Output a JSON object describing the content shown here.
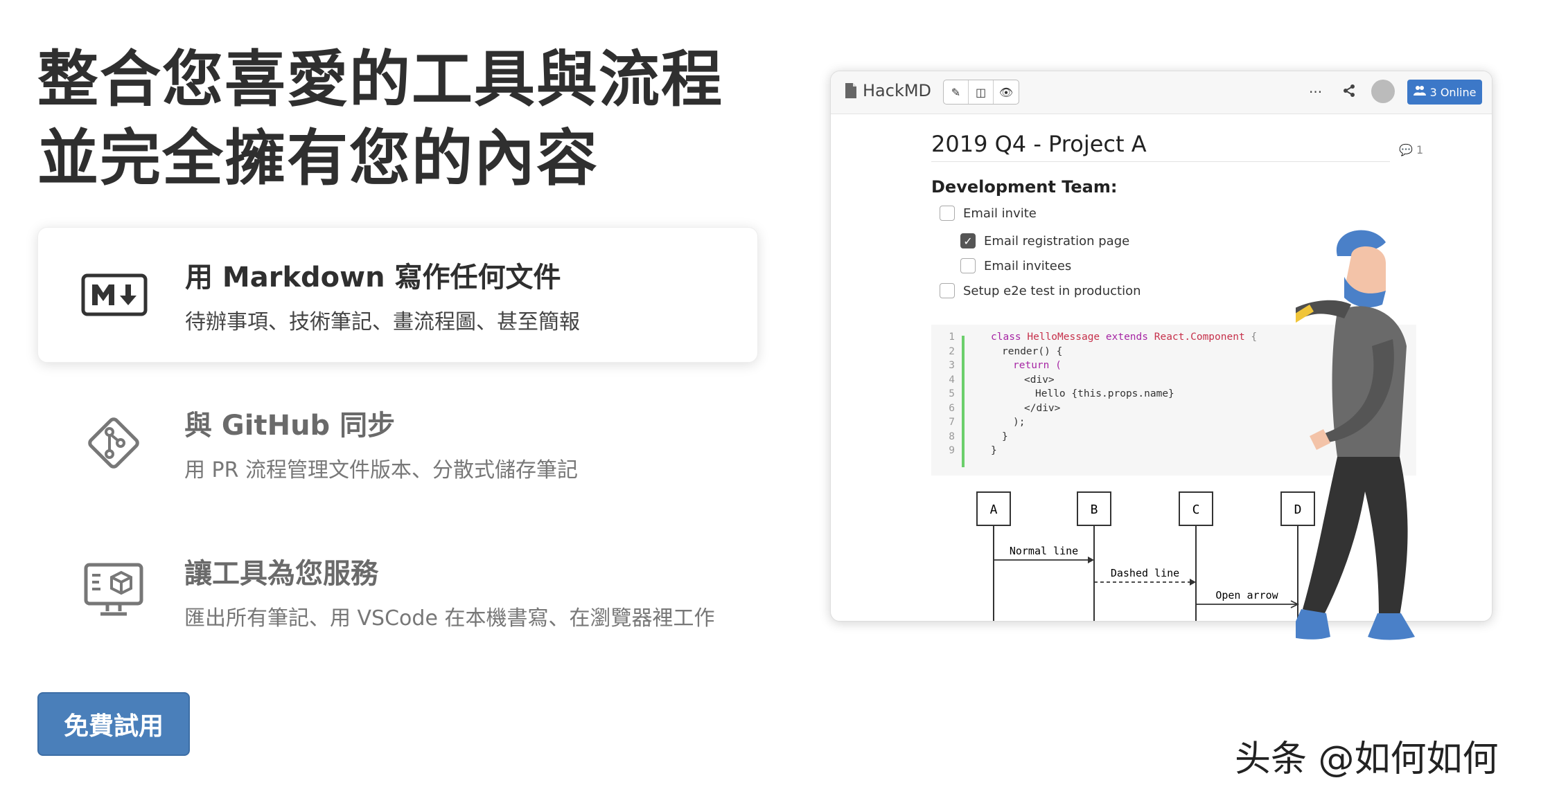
{
  "hero": {
    "title_line1": "整合您喜愛的工具與流程",
    "title_line2": "並完全擁有您的內容"
  },
  "features": [
    {
      "icon": "markdown-icon",
      "title": "用 Markdown 寫作任何文件",
      "desc": "待辦事項、技術筆記、畫流程圖、甚至簡報"
    },
    {
      "icon": "git-icon",
      "title": "與 GitHub 同步",
      "desc": "用 PR 流程管理文件版本、分散式儲存筆記"
    },
    {
      "icon": "monitor-box-icon",
      "title": "讓工具為您服務",
      "desc": "匯出所有筆記、用 VSCode 在本機書寫、在瀏覽器裡工作"
    }
  ],
  "cta_label": "免費試用",
  "watermark": "头条 @如何如何",
  "editor": {
    "brand": "HackMD",
    "online_label": "3 Online",
    "more": "···",
    "doc_title": "2019 Q4 - Project A",
    "comment_count": "1",
    "section": "Development Team:",
    "tasks": [
      {
        "label": "Email invite",
        "checked": false
      },
      {
        "label": "Email registration page",
        "checked": true
      },
      {
        "label": "Email invitees",
        "checked": false
      },
      {
        "label": "Setup e2e test in production",
        "checked": false
      }
    ],
    "code_line_numbers": [
      "1",
      "2",
      "3",
      "4",
      "5",
      "6",
      "7",
      "8",
      "9"
    ],
    "code": [
      {
        "kw": "class ",
        "cls": "HelloMessage ",
        "kw2": "extends ",
        "cls2": "React.Component ",
        "pun": "{"
      },
      "render() {",
      "return (",
      "<div>",
      "Hello {this.props.name}",
      "</div>",
      ");",
      "}",
      "}"
    ],
    "sequence": {
      "actors": [
        "A",
        "B",
        "C",
        "D"
      ],
      "messages": [
        "Normal line",
        "Dashed line",
        "Open arrow"
      ]
    }
  },
  "colors": {
    "cta": "#4a7fba",
    "online_badge": "#3c78c8",
    "code_bar": "#6ccf6c"
  }
}
